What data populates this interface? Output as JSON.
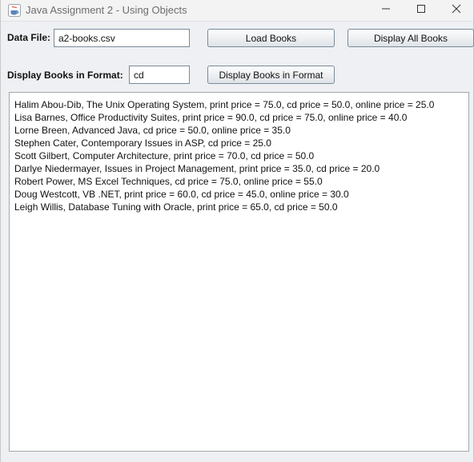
{
  "window": {
    "title": "Java Assignment 2 - Using Objects"
  },
  "form": {
    "data_file_label": "Data File:",
    "data_file_value": "a2-books.csv",
    "load_button": "Load Books",
    "display_all_button": "Display All Books",
    "format_label": "Display Books in Format:",
    "format_value": "cd",
    "display_format_button": "Display Books in Format"
  },
  "output": {
    "lines": [
      "Halim Abou-Dib, The Unix Operating System, print price = 75.0, cd price = 50.0, online price = 25.0",
      "Lisa Barnes, Office Productivity Suites, print price = 90.0, cd price = 75.0, online price = 40.0",
      "Lorne Breen, Advanced Java, cd price = 50.0, online price = 35.0",
      "Stephen Cater, Contemporary Issues in ASP, cd price = 25.0",
      "Scott Gilbert, Computer Architecture, print price = 70.0, cd price = 50.0",
      "Darlye Niedermayer, Issues in Project Management, print price = 35.0, cd price = 20.0",
      "Robert Power, MS Excel Techniques, cd price = 75.0, online price = 55.0",
      "Doug Westcott, VB .NET, print price = 60.0, cd price = 45.0, online price = 30.0",
      "Leigh Willis, Database Tuning with Oracle, print price = 65.0, cd price = 50.0"
    ]
  },
  "icons": {
    "app": "java-cup-icon",
    "minimize": "minimize-icon",
    "maximize": "maximize-icon",
    "close": "close-icon"
  }
}
